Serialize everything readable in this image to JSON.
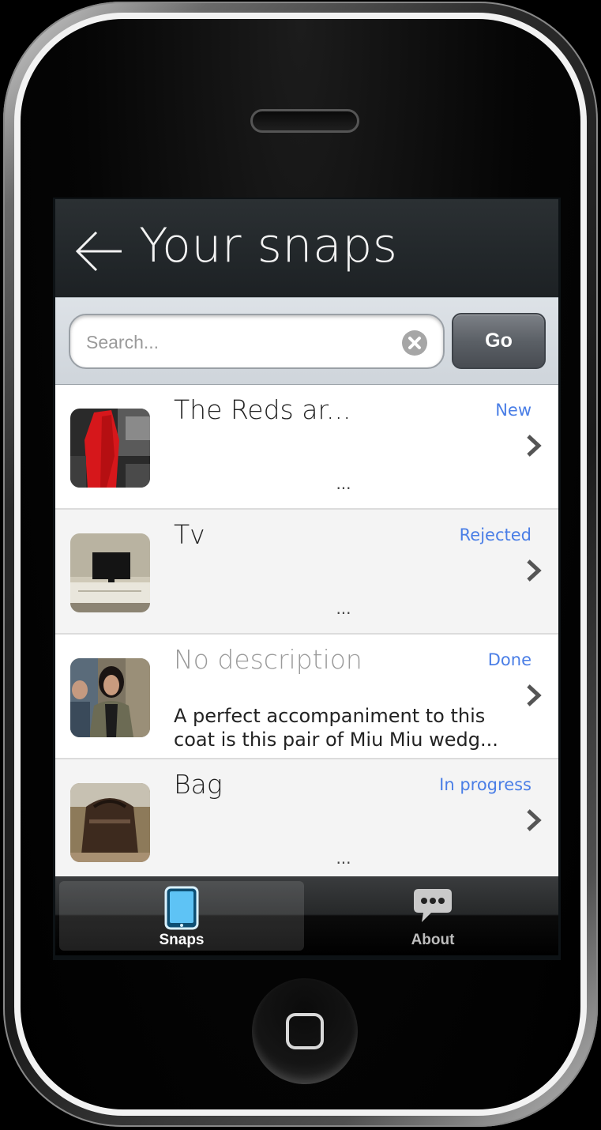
{
  "header": {
    "title": "Your snaps",
    "back_icon": "back-arrow-icon"
  },
  "search": {
    "placeholder": "Search...",
    "value": "",
    "go_label": "Go",
    "clear_icon": "clear-circle-icon"
  },
  "snaps": [
    {
      "title": "The Reds ar...",
      "status": "New",
      "description": "...",
      "has_description": true,
      "thumb": "red-coat-photo"
    },
    {
      "title": "Tv",
      "status": "Rejected",
      "description": "...",
      "has_description": true,
      "thumb": "tv-photo"
    },
    {
      "title": "No description",
      "status": "Done",
      "description": "A perfect accompaniment to this coat is this pair of Miu Miu wedg...",
      "has_description": false,
      "thumb": "woman-photo"
    },
    {
      "title": "Bag",
      "status": "In progress",
      "description": "...",
      "has_description": true,
      "thumb": "bag-photo"
    }
  ],
  "tabs": [
    {
      "label": "Snaps",
      "icon": "tablet-icon",
      "active": true
    },
    {
      "label": "About",
      "icon": "speech-bubble-icon",
      "active": false
    }
  ],
  "colors": {
    "status": "#4a7ee6",
    "header_bg": "#22272a",
    "tab_active_icon": "#5ec3f5"
  }
}
